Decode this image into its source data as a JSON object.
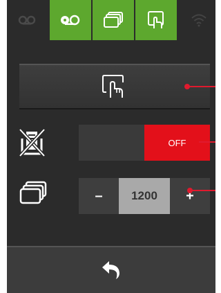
{
  "topbar": {
    "tabs": [
      {
        "icon": "video-off-icon",
        "active": false
      },
      {
        "icon": "video-icon",
        "active": true
      },
      {
        "icon": "stack-icon",
        "active": true
      },
      {
        "icon": "touch-screen-icon",
        "active": true
      },
      {
        "icon": "wifi-icon",
        "active": false
      }
    ]
  },
  "main": {
    "touch_button_icon": "touch-screen-icon",
    "toggle": {
      "icon": "no-paper-icon",
      "state_label": "OFF"
    },
    "stepper": {
      "icon": "stack-icon",
      "minus_label": "–",
      "value": "1200",
      "plus_label": "+"
    }
  },
  "footer": {
    "back_icon": "back-arrow-icon"
  },
  "colors": {
    "accent_green": "#5da82e",
    "off_red": "#e3101a",
    "callout_red": "#e01a2e",
    "panel_bg": "#2b2b2b"
  }
}
